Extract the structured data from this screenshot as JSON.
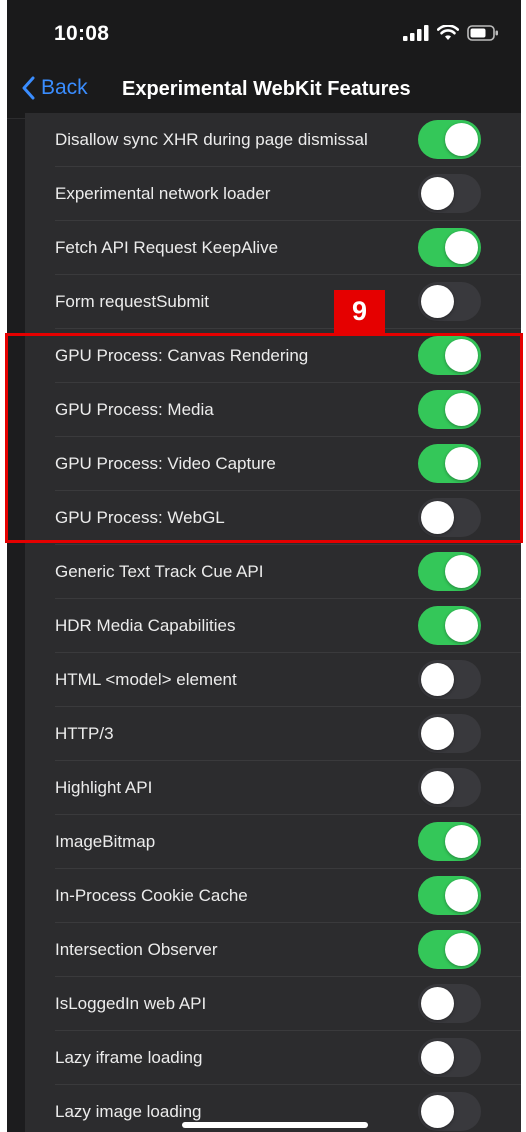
{
  "status_bar": {
    "time": "10:08",
    "icons": [
      "signal-bars-icon",
      "wifi-icon",
      "battery-icon"
    ]
  },
  "nav": {
    "back_label": "Back",
    "title": "Experimental WebKit Features"
  },
  "annotation": {
    "badge": "9",
    "color": "#e50000"
  },
  "colors": {
    "toggle_on": "#34c759",
    "toggle_off": "#39393d",
    "accent": "#3a8dff"
  },
  "settings": [
    {
      "label": "Disallow sync XHR during page dismissal",
      "enabled": true
    },
    {
      "label": "Experimental network loader",
      "enabled": false
    },
    {
      "label": "Fetch API Request KeepAlive",
      "enabled": true
    },
    {
      "label": "Form requestSubmit",
      "enabled": false
    },
    {
      "label": "GPU Process: Canvas Rendering",
      "enabled": true
    },
    {
      "label": "GPU Process: Media",
      "enabled": true
    },
    {
      "label": "GPU Process: Video Capture",
      "enabled": true
    },
    {
      "label": "GPU Process: WebGL",
      "enabled": false
    },
    {
      "label": "Generic Text Track Cue API",
      "enabled": true
    },
    {
      "label": "HDR Media Capabilities",
      "enabled": true
    },
    {
      "label": "HTML <model> element",
      "enabled": false
    },
    {
      "label": "HTTP/3",
      "enabled": false
    },
    {
      "label": "Highlight API",
      "enabled": false
    },
    {
      "label": "ImageBitmap",
      "enabled": true
    },
    {
      "label": "In-Process Cookie Cache",
      "enabled": true
    },
    {
      "label": "Intersection Observer",
      "enabled": true
    },
    {
      "label": "IsLoggedIn web API",
      "enabled": false
    },
    {
      "label": "Lazy iframe loading",
      "enabled": false
    },
    {
      "label": "Lazy image loading",
      "enabled": false
    }
  ]
}
